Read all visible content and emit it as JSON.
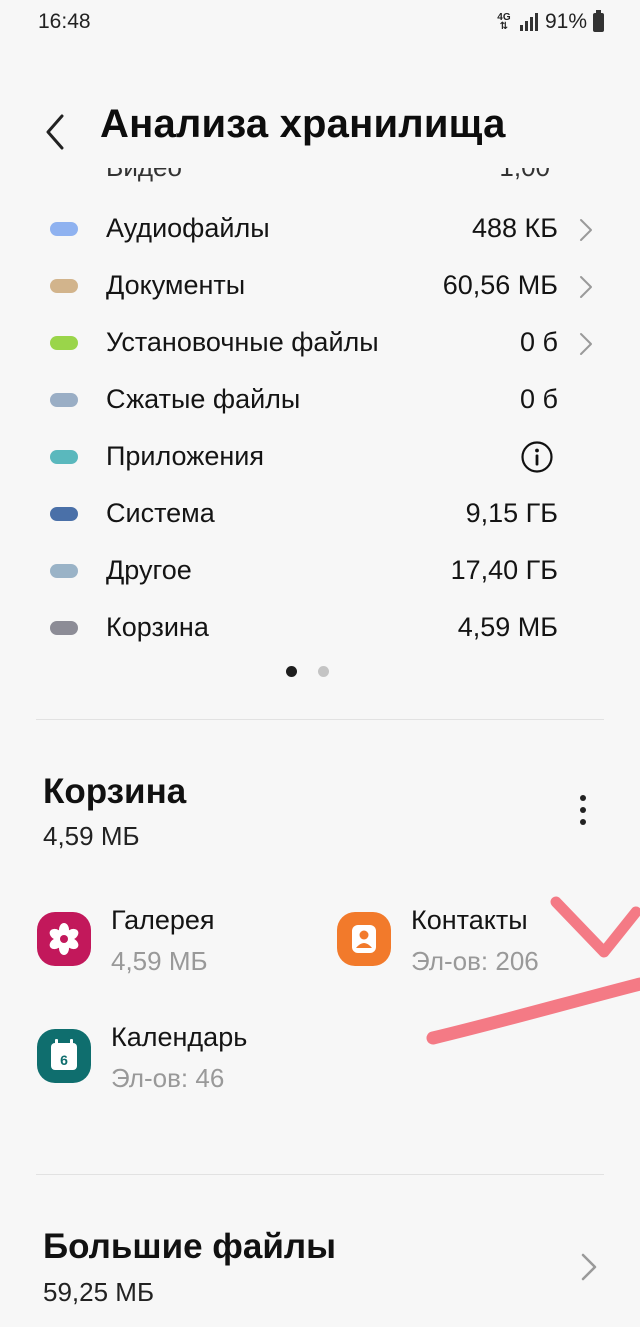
{
  "status": {
    "time": "16:48",
    "network": "4G",
    "battery": "91%"
  },
  "header": {
    "title": "Анализа хранилища"
  },
  "categories": [
    {
      "name": "Аудиофайлы",
      "size": "488 КБ",
      "color": "#8fb2f0",
      "chevron": true
    },
    {
      "name": "Документы",
      "size": "60,56 МБ",
      "color": "#d2b48c",
      "chevron": true
    },
    {
      "name": "Установочные файлы",
      "size": "0 б",
      "color": "#9ad54a",
      "chevron": true
    },
    {
      "name": "Сжатые файлы",
      "size": "0 б",
      "color": "#9aaec5",
      "chevron": false
    },
    {
      "name": "Приложения",
      "size": "",
      "color": "#5ab8bd",
      "chevron": false,
      "icon": "info-icon"
    },
    {
      "name": "Система",
      "size": "9,15 ГБ",
      "color": "#4a70a8",
      "chevron": false
    },
    {
      "name": "Другое",
      "size": "17,40 ГБ",
      "color": "#9ab3c7",
      "chevron": false
    },
    {
      "name": "Корзина",
      "size": "4,59 МБ",
      "color": "#8c8c96",
      "chevron": false
    }
  ],
  "pager": {
    "count": 2,
    "active": 1
  },
  "trash": {
    "title": "Корзина",
    "size": "4,59 МБ",
    "apps": [
      {
        "name": "Галерея",
        "sub": "4,59 МБ",
        "icon": "gallery-flower-icon",
        "color": "#c2185b"
      },
      {
        "name": "Контакты",
        "sub": "Эл-ов: 206",
        "icon": "contacts-person-icon",
        "color": "#f27a2b"
      },
      {
        "name": "Календарь",
        "sub": "Эл-ов: 46",
        "icon": "calendar-icon",
        "color": "#0f6e6e",
        "day": "6"
      }
    ]
  },
  "large_files": {
    "title": "Большие файлы",
    "size": "59,25 МБ"
  },
  "annotation_color": "#f36b78"
}
